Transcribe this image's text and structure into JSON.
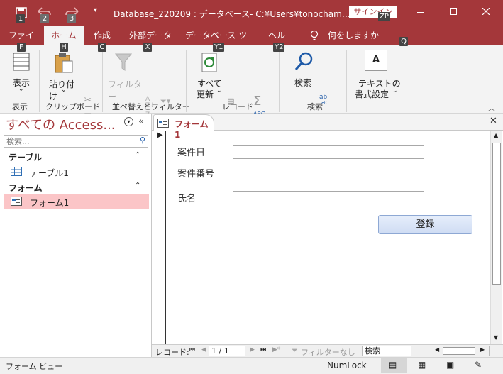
{
  "titlebar": {
    "title": "Database_220209 : データベース- C:¥Users¥tonocham…",
    "signin": "サインイン",
    "keytips": {
      "save": "1",
      "undo": "2",
      "redo": "3",
      "signin": "ZP"
    }
  },
  "tabs": [
    {
      "label": "ファイル",
      "keytip": "F"
    },
    {
      "label": "ホーム",
      "keytip": "H"
    },
    {
      "label": "作成",
      "keytip": "C"
    },
    {
      "label": "外部データ",
      "keytip": "X"
    },
    {
      "label": "データベース ツール",
      "keytip": "Y1"
    },
    {
      "label": "ヘルプ",
      "keytip": "Y2"
    },
    {
      "label": "何をしますか",
      "keytip": "Q"
    }
  ],
  "ribbon": {
    "view_label": "表示",
    "paste_label": "貼り付け",
    "filter_label": "フィルター",
    "refresh_line1": "すべて",
    "refresh_line2": "更新",
    "find_label": "検索",
    "text_format_line1": "テキストの",
    "text_format_line2": "書式設定",
    "groups": {
      "view": "表示",
      "clipboard": "クリップボード",
      "sort_filter": "並べ替えとフィルター",
      "records": "レコード",
      "find": "検索"
    }
  },
  "navpane": {
    "title": "すべての Access...",
    "search_placeholder": "検索...",
    "sections": [
      {
        "header": "テーブル",
        "items": [
          "テーブル1"
        ]
      },
      {
        "header": "フォーム",
        "items": [
          "フォーム1"
        ]
      }
    ]
  },
  "document": {
    "tab_label": "フォーム1",
    "fields": [
      {
        "label": "案件日",
        "value": ""
      },
      {
        "label": "案件番号",
        "value": ""
      },
      {
        "label": "氏名",
        "value": ""
      }
    ],
    "register_button": "登録"
  },
  "record_nav": {
    "label": "レコード:",
    "position": "1 / 1",
    "filter": "フィルターなし",
    "search": "検索"
  },
  "status": {
    "view_name": "フォーム ビュー",
    "numlock": "NumLock"
  },
  "colors": {
    "accent": "#a4373a",
    "selected_item": "#fbc5c7",
    "button": "#dce8f8"
  }
}
